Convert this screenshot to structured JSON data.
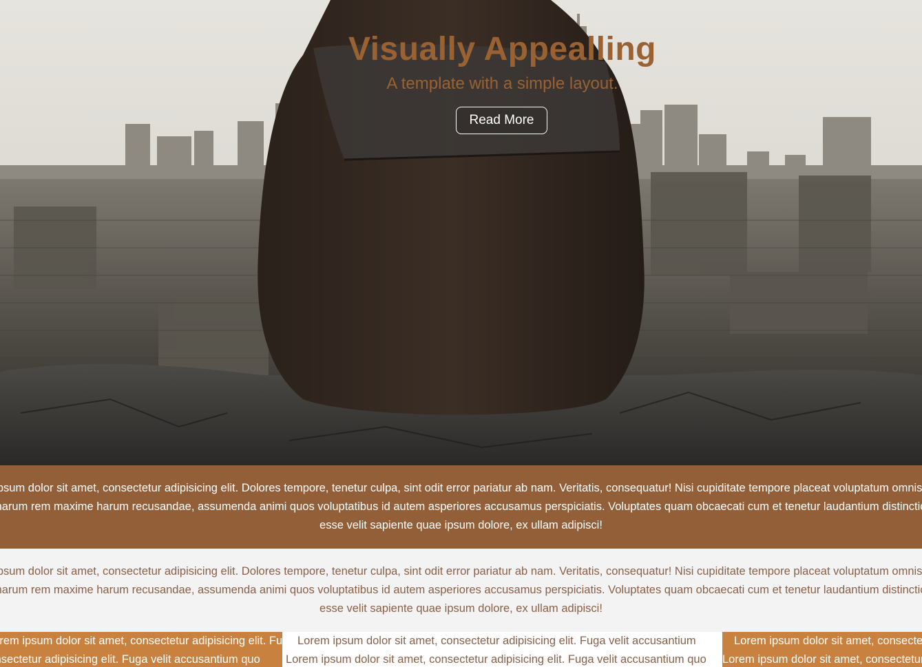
{
  "hero": {
    "title": "Visually Appealling",
    "subtitle": "A template with a simple layout.",
    "button_label": "Read More"
  },
  "band": {
    "line1": "Lorem ipsum dolor sit amet, consectetur adipisicing elit. Dolores tempore, tenetur culpa, sint odit error pariatur ab nam. Veritatis, consequatur! Nisi cupiditate tempore placeat voluptatum omnis dolores",
    "line2": "harum rem maxime harum recusandae, assumenda animi quos voluptatibus id autem asperiores accusamus perspiciatis. Voluptates quam obcaecati cum et tenetur laudantium distinctio",
    "line3": "esse velit sapiente quae ipsum dolore, ex ullam adipisci!"
  },
  "light": {
    "line1": "Lorem ipsum dolor sit amet, consectetur adipisicing elit. Dolores tempore, tenetur culpa, sint odit error pariatur ab nam. Veritatis, consequatur! Nisi cupiditate tempore placeat voluptatum omnis dolores",
    "line2": "harum rem maxime harum recusandae, assumenda animi quos voluptatibus id autem asperiores accusamus perspiciatis. Voluptates quam obcaecati cum et tenetur laudantium distinctio",
    "line3": "esse velit sapiente quae ipsum dolore, ex ullam adipisci!"
  },
  "columns": [
    {
      "line1": "Lorem ipsum dolor sit amet, consectetur adipisicing elit. Fuga velit accusantium",
      "line2": "Lorem ipsum dolor sit amet, consectetur adipisicing elit. Fuga velit accusantium quo"
    },
    {
      "line1": "Lorem ipsum dolor sit amet, consectetur adipisicing elit. Fuga velit accusantium",
      "line2": "Lorem ipsum dolor sit amet, consectetur adipisicing elit. Fuga velit accusantium quo"
    },
    {
      "line1": "Lorem ipsum dolor sit amet, consectetur adipisicing elit. Fuga velit accusantium",
      "line2": "Lorem ipsum dolor sit amet, consectetur adipisicing elit. Fuga velit accusantium quo"
    }
  ],
  "colors": {
    "accent_brown": "#935f38",
    "title_brown": "#9a6233",
    "column_orange": "#c98140",
    "muted_text": "#8a6048"
  }
}
